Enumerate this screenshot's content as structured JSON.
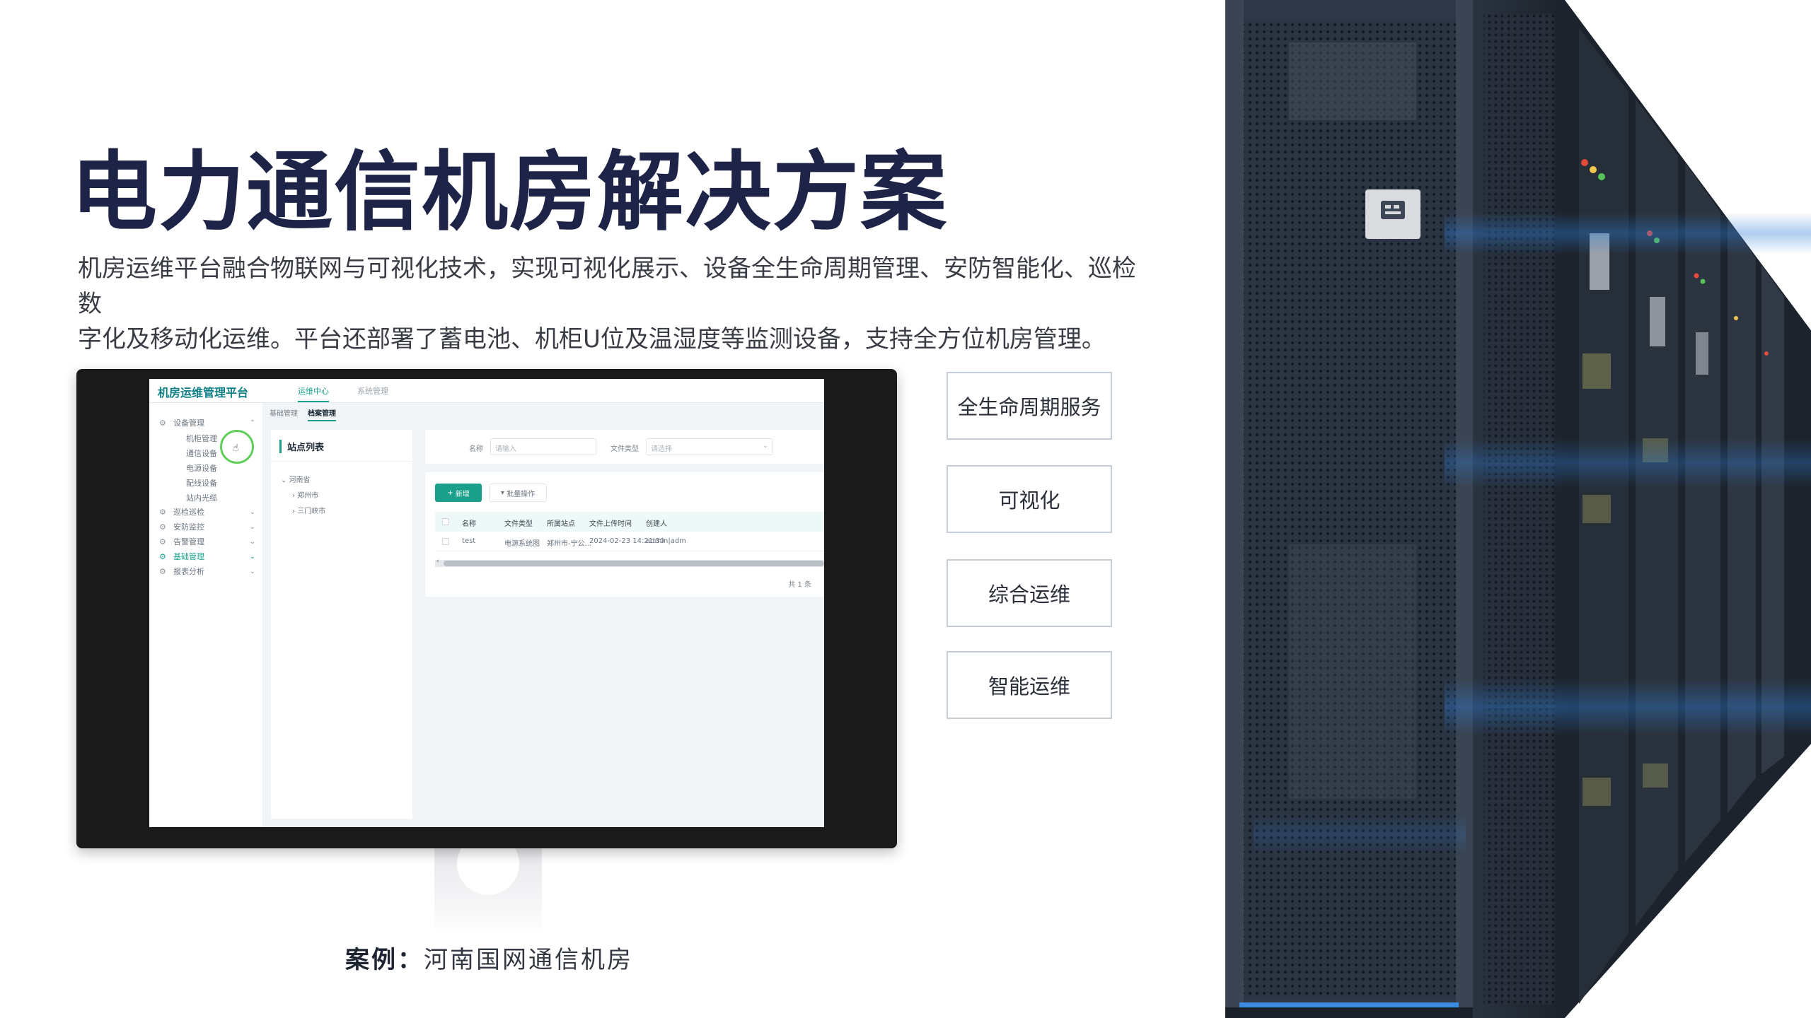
{
  "hero": {
    "title": "电力通信机房解决方案",
    "description_line1": "机房运维平台融合物联网与可视化技术，实现可视化展示、设备全生命周期管理、安防智能化、巡检数",
    "description_line2": "字化及移动化运维。平台还部署了蓄电池、机柜U位及温湿度等监测设备，支持全方位机房管理。"
  },
  "screen_app": {
    "brand": "机房运维管理平台",
    "tabs": [
      {
        "label": "运维中心",
        "active": true
      },
      {
        "label": "系统管理",
        "active": false
      }
    ],
    "sidebar": [
      {
        "label": "设备管理",
        "active": false,
        "expanded": true
      },
      {
        "label": "机柜管理",
        "sub": true
      },
      {
        "label": "通信设备",
        "sub": true
      },
      {
        "label": "电源设备",
        "sub": true
      },
      {
        "label": "配线设备",
        "sub": true
      },
      {
        "label": "站内光缆",
        "sub": true
      },
      {
        "label": "巡检巡检",
        "active": false
      },
      {
        "label": "安防监控",
        "active": false
      },
      {
        "label": "告警管理",
        "active": false
      },
      {
        "label": "基础管理",
        "active": true
      },
      {
        "label": "报表分析",
        "active": false
      }
    ],
    "breadcrumb": [
      "基础管理",
      "档案管理"
    ],
    "tree": {
      "title": "站点列表",
      "nodes": [
        "河南省",
        "郑州市",
        "三门峡市"
      ]
    },
    "filters": {
      "name_label": "名称",
      "name_placeholder": "请输入",
      "type_label": "文件类型",
      "type_placeholder": "请选择"
    },
    "buttons": {
      "add": "新增",
      "batch": "批量操作"
    },
    "table": {
      "columns": [
        "名称",
        "文件类型",
        "所属站点",
        "文件上传时间",
        "创建人"
      ],
      "rows": [
        [
          "test",
          "电源系统图",
          "郑州市-宁公...",
          "2024-02-23 14:21:30",
          "admin|adm"
        ]
      ],
      "total": "共 1 条"
    }
  },
  "case": {
    "label": "案例：",
    "name": "河南国网通信机房"
  },
  "features": [
    "全生命周期服务",
    "可视化",
    "综合运维",
    "智能运维"
  ],
  "icons": {
    "gear": "gear-icon",
    "chevron": "chevron-down-icon",
    "hand": "hand-cursor-icon",
    "plus": "plus-icon"
  },
  "colors": {
    "title": "#1d2447",
    "accent": "#1aa08a",
    "rack_glow": "#2f7fd8"
  }
}
